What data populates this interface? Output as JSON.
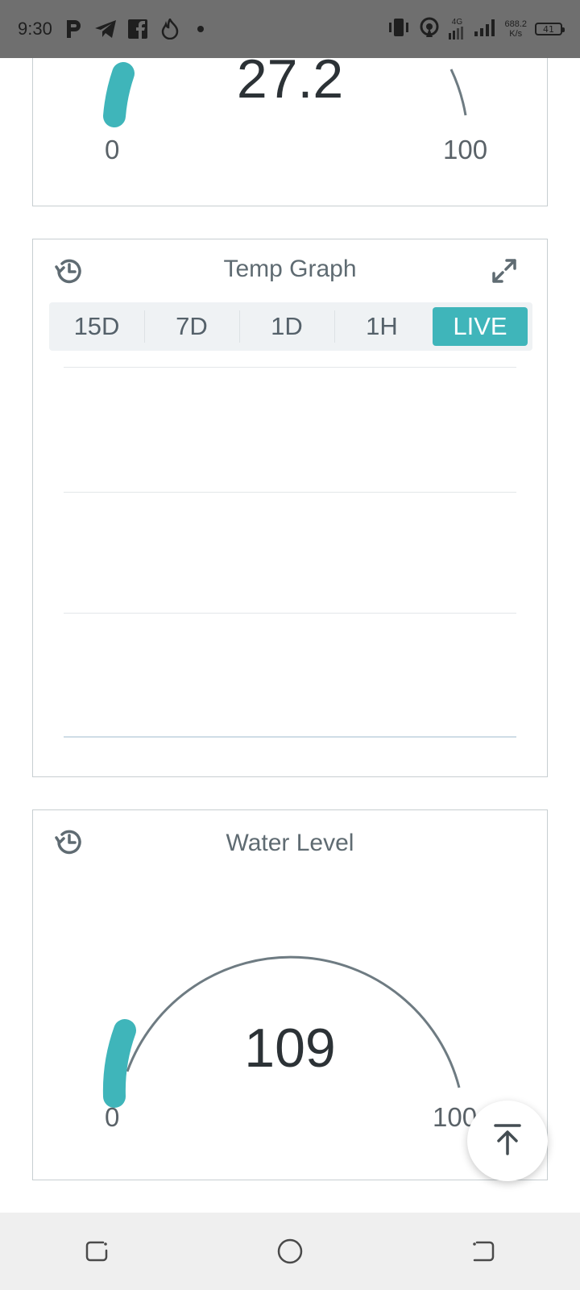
{
  "status_bar": {
    "time": "9:30",
    "network_speed": "688.2",
    "network_speed_unit": "K/s",
    "network_type": "4G",
    "battery_level": "41",
    "icons": [
      "p-icon",
      "telegram-icon",
      "facebook-icon",
      "fire-icon",
      "dot-icon",
      "vibrate-icon",
      "hotspot-icon",
      "4g-icon",
      "signal-icon",
      "battery-icon"
    ]
  },
  "temperature_gauge": {
    "value": "27.2",
    "min": "0",
    "max": "100",
    "level_fraction": 0.272
  },
  "temp_graph": {
    "title": "Temp Graph",
    "ranges": [
      "15D",
      "7D",
      "1D",
      "1H",
      "LIVE"
    ],
    "active_range": "LIVE"
  },
  "water_level": {
    "title": "Water Level",
    "value": "109",
    "min": "0",
    "max": "100",
    "max_visible": "10"
  },
  "colors": {
    "accent": "#3fb5ba",
    "gauge_track": "#6e7b82",
    "status_bar": "#6f6f6f",
    "nav_bar": "#efefef"
  },
  "navigation": {
    "buttons": [
      "recent-apps",
      "home",
      "back"
    ]
  }
}
